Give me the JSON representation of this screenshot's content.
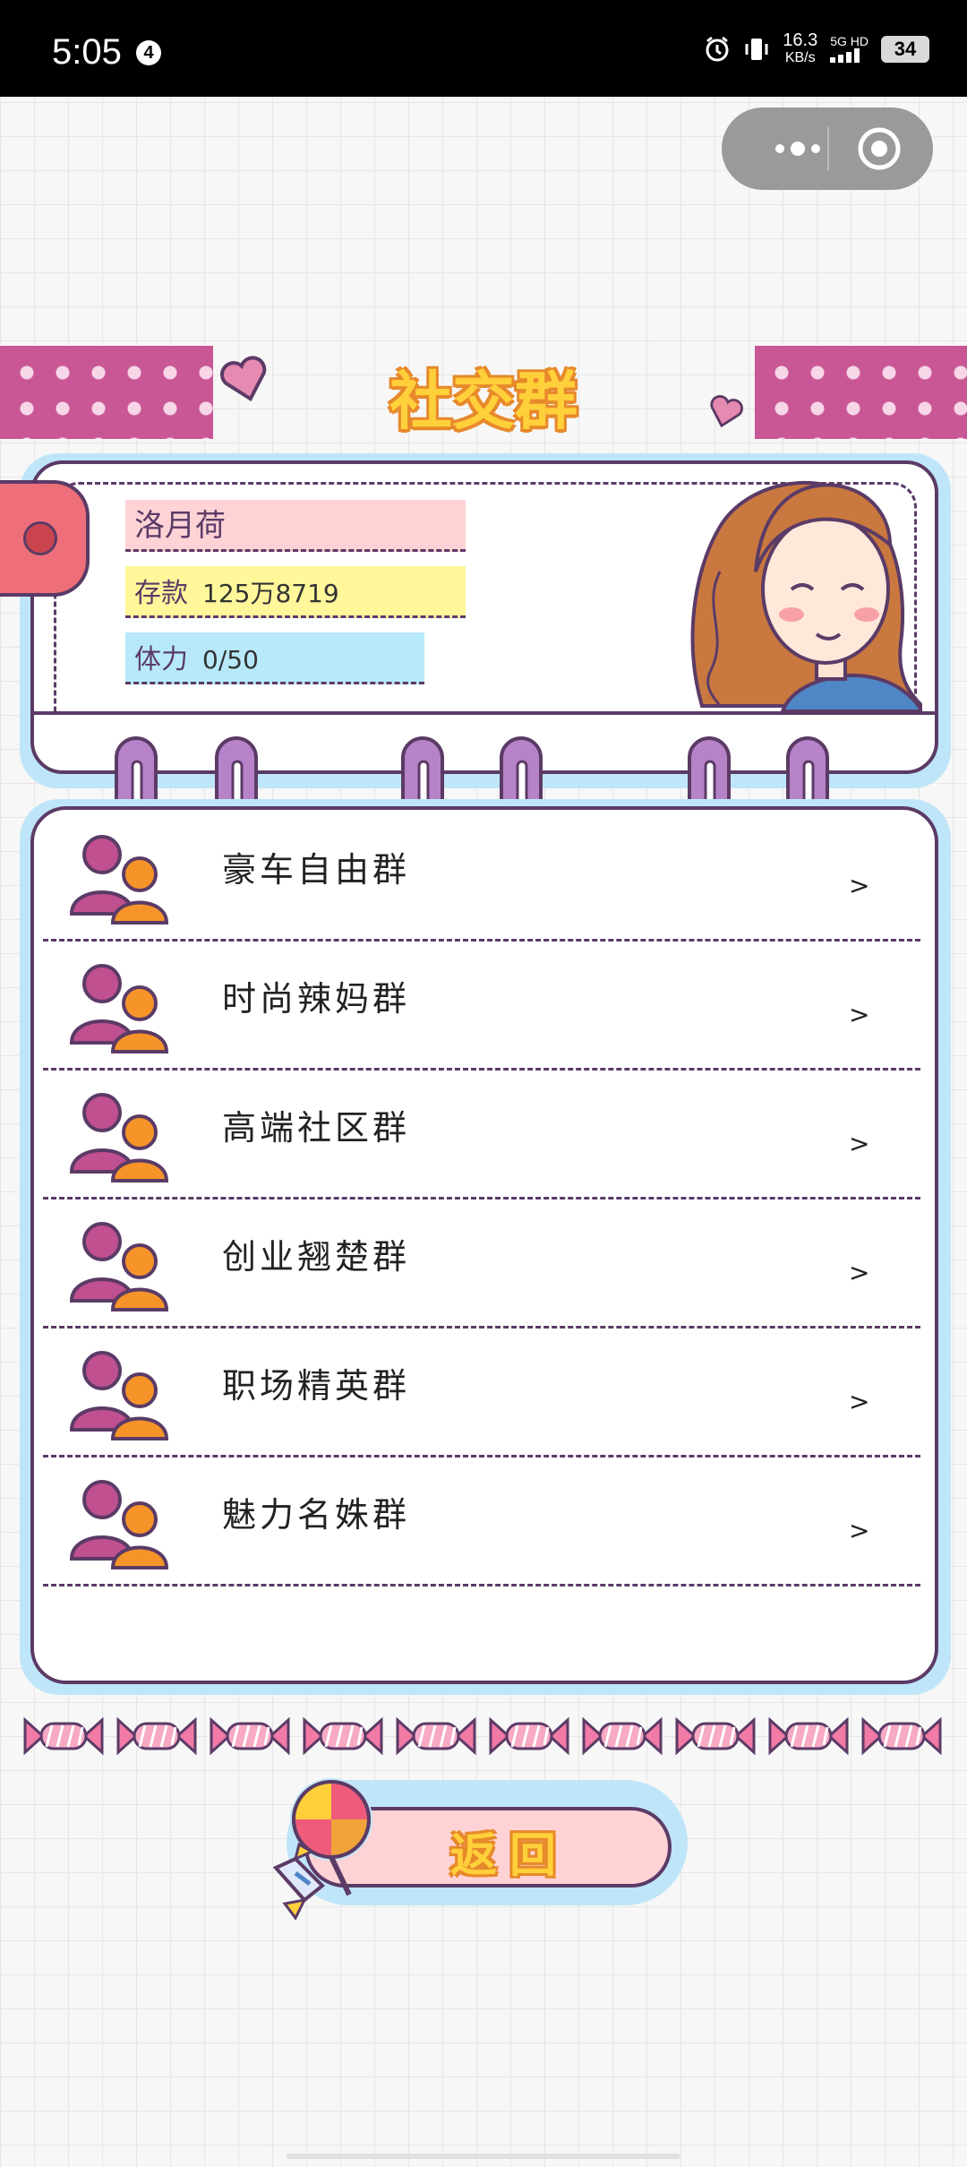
{
  "status_bar": {
    "time": "5:05",
    "notification_badge": "4",
    "speed_value": "16.3",
    "speed_unit": "KB/s",
    "network_top": "5G HD",
    "battery": "34",
    "icons": [
      "alarm-icon",
      "vibrate-icon",
      "signal-icon"
    ]
  },
  "capsule": {
    "more_icon": "more-dots-icon",
    "close_icon": "target-close-icon"
  },
  "page": {
    "title": "社交群"
  },
  "profile": {
    "name": "洛月荷",
    "money_label": "存款",
    "money_value": "125万8719",
    "power_label": "体力",
    "power_value": "0/50",
    "avatar_icon": "woman-avatar-illustration"
  },
  "groups": [
    {
      "name": "豪车自由群",
      "icon": "people-icon",
      "chevron": ">"
    },
    {
      "name": "时尚辣妈群",
      "icon": "people-icon",
      "chevron": ">"
    },
    {
      "name": "高端社区群",
      "icon": "people-icon",
      "chevron": ">"
    },
    {
      "name": "创业翘楚群",
      "icon": "people-icon",
      "chevron": ">"
    },
    {
      "name": "职场精英群",
      "icon": "people-icon",
      "chevron": ">"
    },
    {
      "name": "魅力名姝群",
      "icon": "people-icon",
      "chevron": ">"
    }
  ],
  "back_button": {
    "label": "返回",
    "icon": "lollipop-candy-icon"
  },
  "colors": {
    "accent_pink": "#c95795",
    "outline_purple": "#5b3b66",
    "title_yellow": "#ffd03a",
    "title_orange": "#e7892b",
    "frame_blue": "#bfe6f8"
  }
}
